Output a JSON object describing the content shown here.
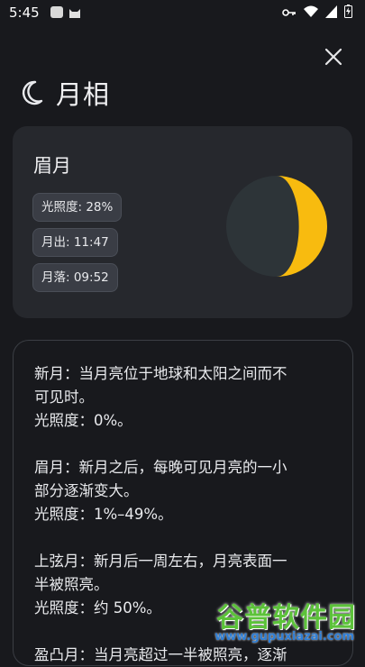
{
  "status_bar": {
    "time": "5:45",
    "icons": [
      "hms-icon",
      "cat-icon",
      "key-icon",
      "wifi-icon",
      "signal-icon",
      "battery-icon"
    ]
  },
  "header": {
    "title": "月相",
    "icon": "crescent-moon-icon"
  },
  "phase_card": {
    "phase_name": "眉月",
    "illumination": "光照度: 28%",
    "moonrise": "月出: 11:47",
    "moonset": "月落: 09:52",
    "illumination_fraction": 0.28,
    "lit_color": "#f8bb0f",
    "dark_color": "#2d3438"
  },
  "info": {
    "paragraphs": [
      {
        "line1": "新月：当月亮位于地球和太阳之间而不",
        "line2": "可见时。",
        "line3": "光照度：0%。"
      },
      {
        "line1": "眉月：新月之后，每晚可见月亮的一小",
        "line2": "部分逐渐变大。",
        "line3": "光照度：1%–49%。"
      },
      {
        "line1": "上弦月：新月后一周左右，月亮表面一",
        "line2": "半被照亮。",
        "line3": "光照度：约 50%。"
      },
      {
        "line1": "盈凸月：当月亮超过一半被照亮，逐渐",
        "line2": "",
        "line3": ""
      }
    ]
  },
  "watermark": {
    "text": "谷普软件园",
    "url": "www.gupuxiazai.com"
  }
}
